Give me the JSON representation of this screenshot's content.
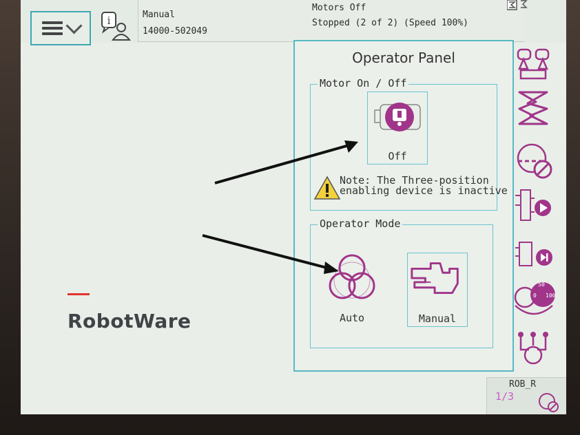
{
  "topbar": {
    "mode": "Manual",
    "controller_id": "14000-502049",
    "motors_state": "Motors Off",
    "program_state": "Stopped (2 of 2) (Speed 100%)"
  },
  "operator_panel": {
    "title": "Operator Panel",
    "motor_group_label": "Motor On / Off",
    "motor_button_label": "Off",
    "note_line1": "Note: The Three-position",
    "note_line2": "enabling device is inactive",
    "mode_group_label": "Operator Mode",
    "auto_label": "Auto",
    "manual_label": "Manual"
  },
  "branding": {
    "product": "RobotWare"
  },
  "task_area": {
    "task_name": "ROB_R",
    "task_fraction": "1/3"
  },
  "speed_gauge": {
    "labels": [
      "50",
      "0",
      "100"
    ]
  },
  "colors": {
    "accent": "#58b8c6",
    "icon_purple": "#a0358a",
    "brand_red": "#e0332b",
    "warning_yellow": "#f2d13c"
  }
}
